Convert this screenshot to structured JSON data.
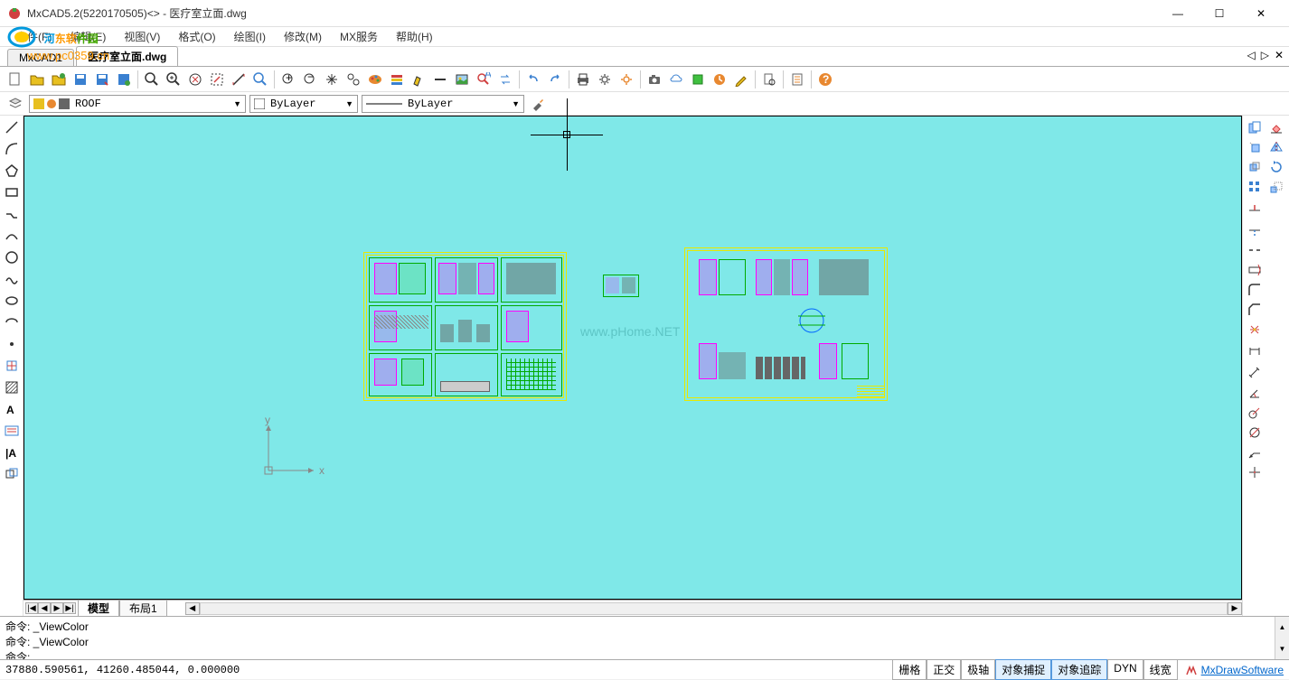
{
  "window": {
    "title": "MxCAD5.2(5220170505)<> - 医疗室立面.dwg",
    "minimize": "—",
    "maximize": "☐",
    "close": "✕"
  },
  "watermark": {
    "part1": "河",
    "part2": "东软",
    "part3": "件园",
    "url": "www.pc0359.cn"
  },
  "menu": {
    "file": "文件(F)",
    "edit": "编辑(E)",
    "view": "视图(V)",
    "format": "格式(O)",
    "draw": "绘图(I)",
    "modify": "修改(M)",
    "mx": "MX服务",
    "help": "帮助(H)"
  },
  "tabs": {
    "tab1": "MxCAD1",
    "tab2": "医疗室立面.dwg"
  },
  "layer": {
    "current": "ROOF",
    "color": "ByLayer",
    "linetype": "ByLayer"
  },
  "layout": {
    "model": "模型",
    "layout1": "布局1"
  },
  "command": {
    "line1": "命令: _ViewColor",
    "line2": "命令: _ViewColor",
    "line3": "命令:"
  },
  "status": {
    "coords": "37880.590561,  41260.485044,  0.000000",
    "grid": "栅格",
    "ortho": "正交",
    "polar": "极轴",
    "osnap": "对象捕捉",
    "otrack": "对象追踪",
    "dyn": "DYN",
    "lwt": "线宽",
    "brand": "MxDrawSoftware"
  },
  "canvas": {
    "watermark": "www.pHome.NET",
    "ucs_y": "y",
    "ucs_x": "x"
  }
}
